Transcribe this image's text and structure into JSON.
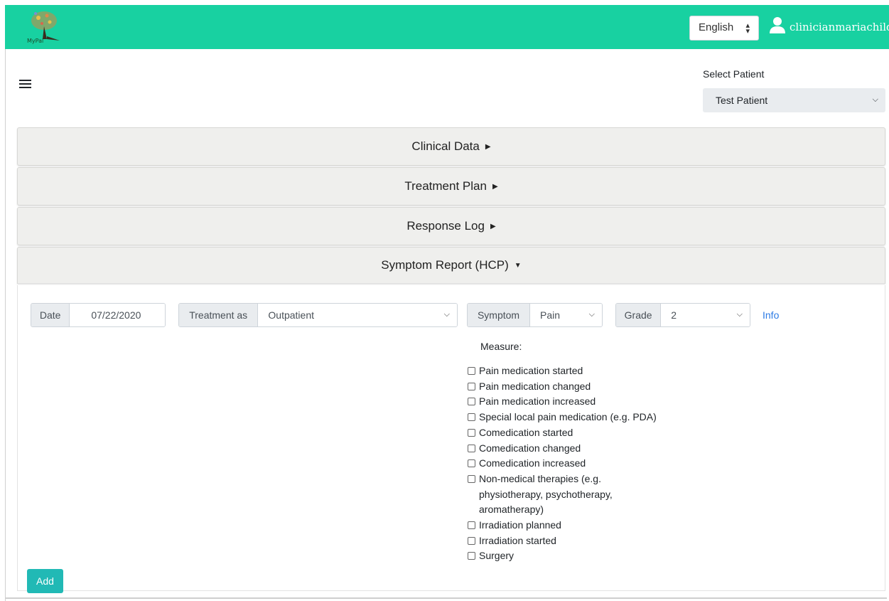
{
  "header": {
    "logo_text": "MyPal",
    "language": "English",
    "username": "clinicianmariachild"
  },
  "patient_selector": {
    "label": "Select Patient",
    "selected": "Test Patient"
  },
  "accordion": {
    "sections": [
      {
        "label": "Clinical Data",
        "state": "collapsed"
      },
      {
        "label": "Treatment Plan",
        "state": "collapsed"
      },
      {
        "label": "Response Log",
        "state": "collapsed"
      },
      {
        "label": "Symptom Report (HCP)",
        "state": "expanded"
      }
    ]
  },
  "symptom_report": {
    "date_label": "Date",
    "date_value": "07/22/2020",
    "treatment_label": "Treatment as",
    "treatment_value": "Outpatient",
    "symptom_label": "Symptom",
    "symptom_value": "Pain",
    "grade_label": "Grade",
    "grade_value": "2",
    "info_link": "Info",
    "measure_label": "Measure:",
    "measures": [
      "Pain medication started",
      "Pain medication changed",
      "Pain medication increased",
      "Special local pain medication (e.g. PDA)",
      "Comedication started",
      "Comedication changed",
      "Comedication increased",
      "Non-medical therapies (e.g. physiotherapy, psychotherapy, aromatherapy)",
      "Irradiation planned",
      "Irradiation started",
      "Surgery"
    ],
    "add_button": "Add"
  },
  "colors": {
    "topbar": "#18d1a1",
    "add_button": "#21b9b5",
    "link": "#2c7be5"
  }
}
